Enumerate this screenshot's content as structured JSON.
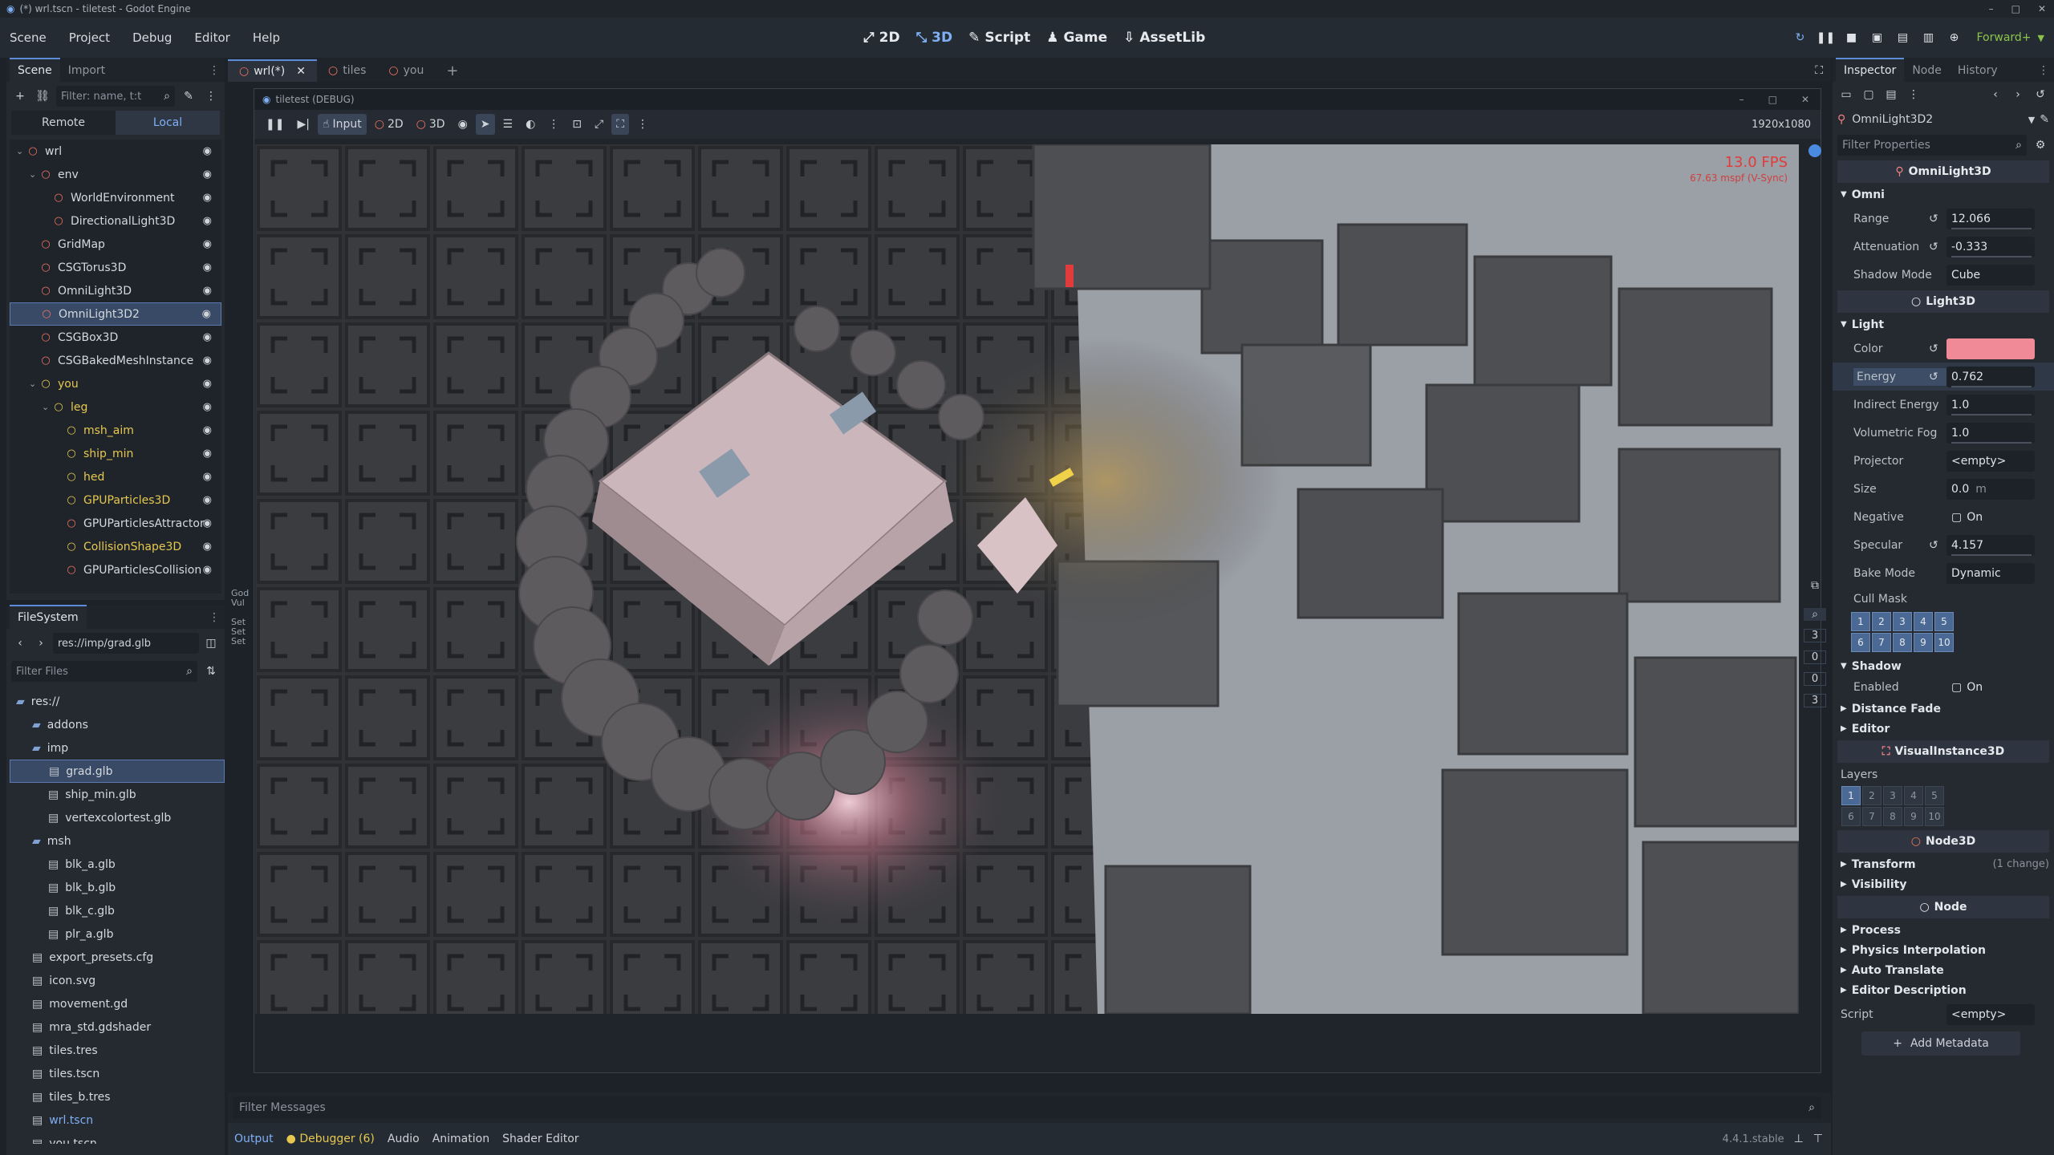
{
  "window_title": "(*) wrl.tscn - tiletest - Godot Engine",
  "menu": [
    "Scene",
    "Project",
    "Debug",
    "Editor",
    "Help"
  ],
  "main_screens": [
    "2D",
    "3D",
    "Script",
    "Game",
    "AssetLib"
  ],
  "renderer": "Forward+",
  "scene_dock": {
    "tabs": [
      "Scene",
      "Import"
    ],
    "filter_placeholder": "Filter: name, t:t",
    "remote_label": "Remote",
    "local_label": "Local",
    "nodes": [
      {
        "name": "wrl",
        "indent": 0,
        "color": "red"
      },
      {
        "name": "env",
        "indent": 1,
        "color": "red"
      },
      {
        "name": "WorldEnvironment",
        "indent": 2,
        "color": "red"
      },
      {
        "name": "DirectionalLight3D",
        "indent": 2,
        "color": "red"
      },
      {
        "name": "GridMap",
        "indent": 1,
        "color": "red"
      },
      {
        "name": "CSGTorus3D",
        "indent": 1,
        "color": "red"
      },
      {
        "name": "OmniLight3D",
        "indent": 1,
        "color": "red"
      },
      {
        "name": "OmniLight3D2",
        "indent": 1,
        "color": "red",
        "selected": true
      },
      {
        "name": "CSGBox3D",
        "indent": 1,
        "color": "red"
      },
      {
        "name": "CSGBakedMeshInstance",
        "indent": 1,
        "color": "red"
      },
      {
        "name": "you",
        "indent": 1,
        "color": "yellow"
      },
      {
        "name": "leg",
        "indent": 2,
        "color": "yellow"
      },
      {
        "name": "msh_aim",
        "indent": 3,
        "color": "yellow"
      },
      {
        "name": "ship_min",
        "indent": 3,
        "color": "yellow"
      },
      {
        "name": "hed",
        "indent": 3,
        "color": "yellow"
      },
      {
        "name": "GPUParticles3D",
        "indent": 3,
        "color": "yellow"
      },
      {
        "name": "GPUParticlesAttractor",
        "indent": 3,
        "color": "red"
      },
      {
        "name": "CollisionShape3D",
        "indent": 3,
        "color": "yellow"
      },
      {
        "name": "GPUParticlesCollision",
        "indent": 3,
        "color": "red"
      }
    ]
  },
  "filesystem": {
    "tab": "FileSystem",
    "path": "res://imp/grad.glb",
    "filter_placeholder": "Filter Files",
    "items": [
      {
        "name": "res://",
        "type": "folder",
        "indent": 0
      },
      {
        "name": "addons",
        "type": "folder",
        "indent": 1
      },
      {
        "name": "imp",
        "type": "folder",
        "indent": 1
      },
      {
        "name": "grad.glb",
        "type": "file",
        "indent": 2,
        "selected": true
      },
      {
        "name": "ship_min.glb",
        "type": "file",
        "indent": 2
      },
      {
        "name": "vertexcolortest.glb",
        "type": "file",
        "indent": 2
      },
      {
        "name": "msh",
        "type": "folder",
        "indent": 1
      },
      {
        "name": "blk_a.glb",
        "type": "file",
        "indent": 2
      },
      {
        "name": "blk_b.glb",
        "type": "file",
        "indent": 2
      },
      {
        "name": "blk_c.glb",
        "type": "file",
        "indent": 2
      },
      {
        "name": "plr_a.glb",
        "type": "file",
        "indent": 2
      },
      {
        "name": "export_presets.cfg",
        "type": "file",
        "indent": 1
      },
      {
        "name": "icon.svg",
        "type": "file",
        "indent": 1
      },
      {
        "name": "movement.gd",
        "type": "file",
        "indent": 1
      },
      {
        "name": "mra_std.gdshader",
        "type": "file",
        "indent": 1
      },
      {
        "name": "tiles.tres",
        "type": "file",
        "indent": 1
      },
      {
        "name": "tiles.tscn",
        "type": "file",
        "indent": 1
      },
      {
        "name": "tiles_b.tres",
        "type": "file",
        "indent": 1
      },
      {
        "name": "wrl.tscn",
        "type": "file",
        "indent": 1,
        "highlight": true
      },
      {
        "name": "you.tscn",
        "type": "file",
        "indent": 1
      }
    ]
  },
  "editor_tabs": [
    "wrl(*)",
    "tiles",
    "you"
  ],
  "game_window": {
    "title": "tiletest (DEBUG)",
    "resolution": "1920x1080",
    "toolbar": [
      "Input",
      "2D",
      "3D"
    ],
    "fps": "13.0 FPS",
    "mspf": "67.63 mspf (V-Sync)"
  },
  "side_numbers": [
    "3",
    "0",
    "0",
    "3"
  ],
  "log_snippet": [
    "God",
    "Vul",
    "",
    "Set",
    "Set",
    "Set"
  ],
  "bottom": {
    "filter_placeholder": "Filter Messages",
    "tabs": [
      "Output",
      "Debugger (6)",
      "Audio",
      "Animation",
      "Shader Editor"
    ],
    "version": "4.4.1.stable"
  },
  "inspector": {
    "tabs": [
      "Inspector",
      "Node",
      "History"
    ],
    "node": "OmniLight3D2",
    "filter_placeholder": "Filter Properties",
    "class_header": "OmniLight3D",
    "omni_group": "Omni",
    "range_label": "Range",
    "range": "12.066",
    "attenuation_label": "Attenuation",
    "attenuation": "-0.333",
    "shadow_mode_label": "Shadow Mode",
    "shadow_mode": "Cube",
    "light_header": "Light3D",
    "light_group": "Light",
    "color_label": "Color",
    "color": "#f08a96",
    "energy_label": "Energy",
    "energy": "0.762",
    "indirect_label": "Indirect Energy",
    "indirect": "1.0",
    "fog_label": "Volumetric Fog",
    "fog": "1.0",
    "projector_label": "Projector",
    "projector": "<empty>",
    "size_label": "Size",
    "size": "0.0",
    "size_unit": "m",
    "negative_label": "Negative",
    "negative": "On",
    "specular_label": "Specular",
    "specular": "4.157",
    "bake_label": "Bake Mode",
    "bake": "Dynamic",
    "cull_label": "Cull Mask",
    "cull_layers": [
      "1",
      "2",
      "3",
      "4",
      "5",
      "6",
      "7",
      "8",
      "9",
      "10"
    ],
    "shadow_group": "Shadow",
    "shadow_enabled_label": "Enabled",
    "shadow_enabled": "On",
    "distance_fade": "Distance Fade",
    "editor_group": "Editor",
    "visual_header": "VisualInstance3D",
    "layers_label": "Layers",
    "layers": [
      "1",
      "2",
      "3",
      "4",
      "5",
      "6",
      "7",
      "8",
      "9",
      "10"
    ],
    "node3d_header": "Node3D",
    "transform": "Transform",
    "transform_note": "(1 change)",
    "visibility": "Visibility",
    "node_header": "Node",
    "process": "Process",
    "physics_interp": "Physics Interpolation",
    "auto_translate": "Auto Translate",
    "editor_desc": "Editor Description",
    "script_label": "Script",
    "script": "<empty>",
    "add_metadata": "Add Metadata"
  }
}
